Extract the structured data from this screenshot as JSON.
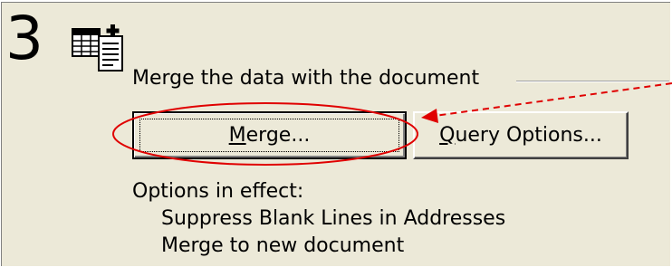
{
  "step": {
    "number": "3",
    "icon": "merge-documents-icon",
    "group_title": "Merge the data with the document"
  },
  "buttons": {
    "merge": {
      "label": "Merge...",
      "mnemonic": "M",
      "rest": "erge..."
    },
    "query_options": {
      "label": "Query Options...",
      "mnemonic": "Q",
      "rest": "uery Options..."
    }
  },
  "options": {
    "heading": "Options in effect:",
    "items": [
      "Suppress Blank Lines in Addresses",
      "Merge to new document"
    ]
  },
  "annotation": {
    "highlight_color": "#e00000",
    "arrow_color": "#e00000",
    "highlight_target": "merge-button"
  }
}
